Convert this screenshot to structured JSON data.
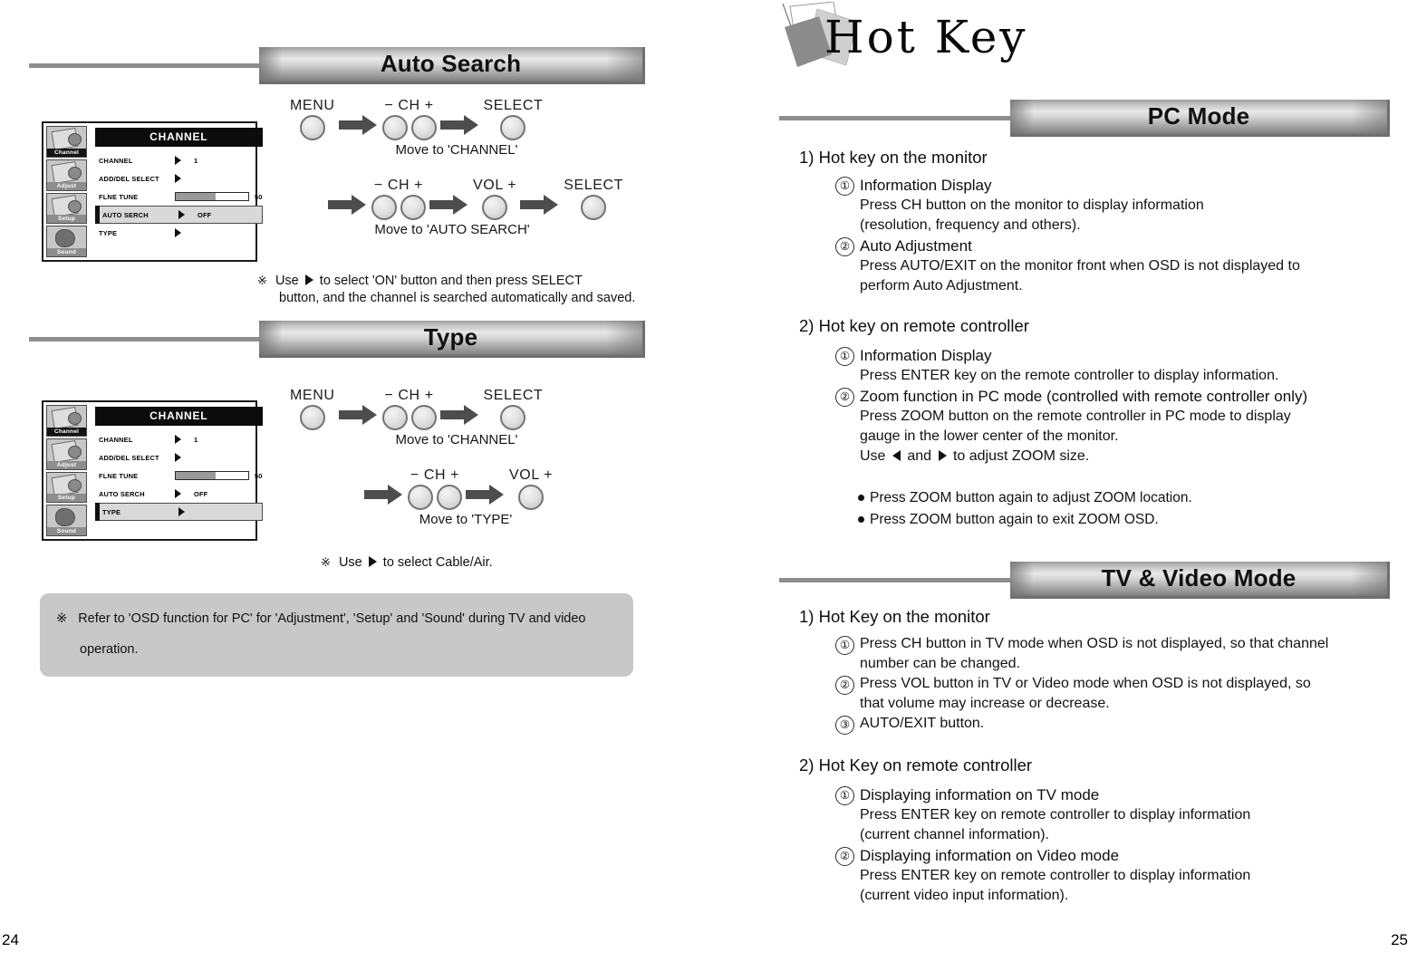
{
  "pages": {
    "left_number": "24",
    "right_number": "25"
  },
  "left": {
    "sections": [
      {
        "banner": "Auto Search"
      },
      {
        "banner": "Type"
      }
    ],
    "osd_auto_search": {
      "title": "CHANNEL",
      "sidebar": [
        {
          "label": "Channel",
          "active": true
        },
        {
          "label": "Adjust",
          "active": false
        },
        {
          "label": "Setup",
          "active": false
        },
        {
          "label": "Sound",
          "active": false
        }
      ],
      "rows": [
        {
          "label": "CHANNEL",
          "value": "1",
          "type": "arrow",
          "selected": false
        },
        {
          "label": "ADD/DEL SELECT",
          "value": "",
          "type": "arrow",
          "selected": false
        },
        {
          "label": "FLNE TUNE",
          "value": "50",
          "type": "slider",
          "fill": 55,
          "selected": false
        },
        {
          "label": "AUTO SERCH",
          "value": "OFF",
          "type": "arrow",
          "selected": true
        },
        {
          "label": "TYPE",
          "value": "",
          "type": "arrow",
          "selected": false
        }
      ]
    },
    "osd_type": {
      "title": "CHANNEL",
      "sidebar": [
        {
          "label": "Channel",
          "active": true
        },
        {
          "label": "Adjust",
          "active": false
        },
        {
          "label": "Setup",
          "active": false
        },
        {
          "label": "Sound",
          "active": false
        }
      ],
      "rows": [
        {
          "label": "CHANNEL",
          "value": "1",
          "type": "arrow",
          "selected": false
        },
        {
          "label": "ADD/DEL SELECT",
          "value": "",
          "type": "arrow",
          "selected": false
        },
        {
          "label": "FLNE TUNE",
          "value": "50",
          "type": "slider",
          "fill": 55,
          "selected": false
        },
        {
          "label": "AUTO SERCH",
          "value": "OFF",
          "type": "arrow",
          "selected": false
        },
        {
          "label": "TYPE",
          "value": "",
          "type": "arrow",
          "selected": true
        }
      ]
    },
    "flow_auto_search": {
      "row1": {
        "buttons": [
          {
            "cap": "MENU",
            "count": 1
          },
          {
            "cap": "−  CH  +",
            "count": 2
          },
          {
            "cap": "SELECT",
            "count": 1
          }
        ],
        "note": "Move to 'CHANNEL'"
      },
      "row2": {
        "buttons": [
          {
            "cap": "−  CH  +",
            "count": 2
          },
          {
            "cap": "VOL +",
            "count": 1
          },
          {
            "cap": "SELECT",
            "count": 1
          }
        ],
        "note": "Move to 'AUTO SEARCH'"
      },
      "hint_line1_a": "Use",
      "hint_line1_b": "to select 'ON' button and then press SELECT",
      "hint_line2": "button, and the channel is searched automatically and saved."
    },
    "flow_type": {
      "row1": {
        "buttons": [
          {
            "cap": "MENU",
            "count": 1
          },
          {
            "cap": "−  CH  +",
            "count": 2
          },
          {
            "cap": "SELECT",
            "count": 1
          }
        ],
        "note": "Move to 'CHANNEL'"
      },
      "row2": {
        "buttons": [
          {
            "cap": "−  CH  +",
            "count": 2
          },
          {
            "cap": "VOL +",
            "count": 1
          }
        ],
        "note": "Move to 'TYPE'"
      },
      "hint_a": "Use",
      "hint_b": "to select Cable/Air."
    },
    "notebox": {
      "line1": "Refer to 'OSD function for PC' for 'Adjustment', 'Setup' and 'Sound' during TV and video",
      "line2": "operation."
    }
  },
  "right": {
    "logo": "Hot  Key",
    "sections": [
      {
        "banner": "PC Mode",
        "groups": [
          {
            "title": "1) Hot key on the monitor",
            "items": [
              {
                "num": "①",
                "head": "Information Display",
                "lines": [
                  "Press CH button on the monitor to display information",
                  "(resolution, frequency and others)."
                ]
              },
              {
                "num": "②",
                "head": "Auto Adjustment",
                "lines": [
                  "Press AUTO/EXIT on the monitor front when OSD is not displayed to",
                  "perform Auto Adjustment."
                ]
              }
            ]
          },
          {
            "title": "2)  Hot key on remote controller",
            "items": [
              {
                "num": "①",
                "head": "Information Display",
                "lines": [
                  "Press ENTER key on the remote controller to display information."
                ]
              },
              {
                "num": "②",
                "head": "Zoom function in PC mode (controlled with remote controller only)",
                "lines": [
                  "Press ZOOM button on the remote controller in PC mode to display",
                  "gauge in the lower center of the monitor."
                ],
                "use_line": {
                  "prefix": "Use",
                  "middle": "and",
                  "suffix": "to adjust ZOOM size."
                }
              }
            ],
            "bullets": [
              "Press ZOOM button again to adjust ZOOM location.",
              "Press ZOOM button again to exit ZOOM OSD."
            ]
          }
        ]
      },
      {
        "banner": "TV & Video Mode",
        "groups": [
          {
            "title": "1) Hot Key on the monitor",
            "items": [
              {
                "num": "①",
                "head": "",
                "lines": [
                  "Press CH button in TV mode when OSD is not displayed, so that channel",
                  "number can be changed."
                ]
              },
              {
                "num": "②",
                "head": "",
                "lines": [
                  "Press VOL button in TV or Video mode when OSD is not displayed, so",
                  "that volume may increase or decrease."
                ]
              },
              {
                "num": "③",
                "head": "",
                "lines": [
                  "AUTO/EXIT button."
                ]
              }
            ]
          },
          {
            "title": "2)  Hot Key on remote controller",
            "items": [
              {
                "num": "①",
                "head": "Displaying information on TV mode",
                "lines": [
                  "Press ENTER key on remote controller to display information",
                  "(current channel information)."
                ]
              },
              {
                "num": "②",
                "head": "Displaying information on Video mode",
                "lines": [
                  "Press ENTER key on remote controller to display information",
                  "(current video input information)."
                ]
              }
            ]
          }
        ]
      }
    ]
  }
}
